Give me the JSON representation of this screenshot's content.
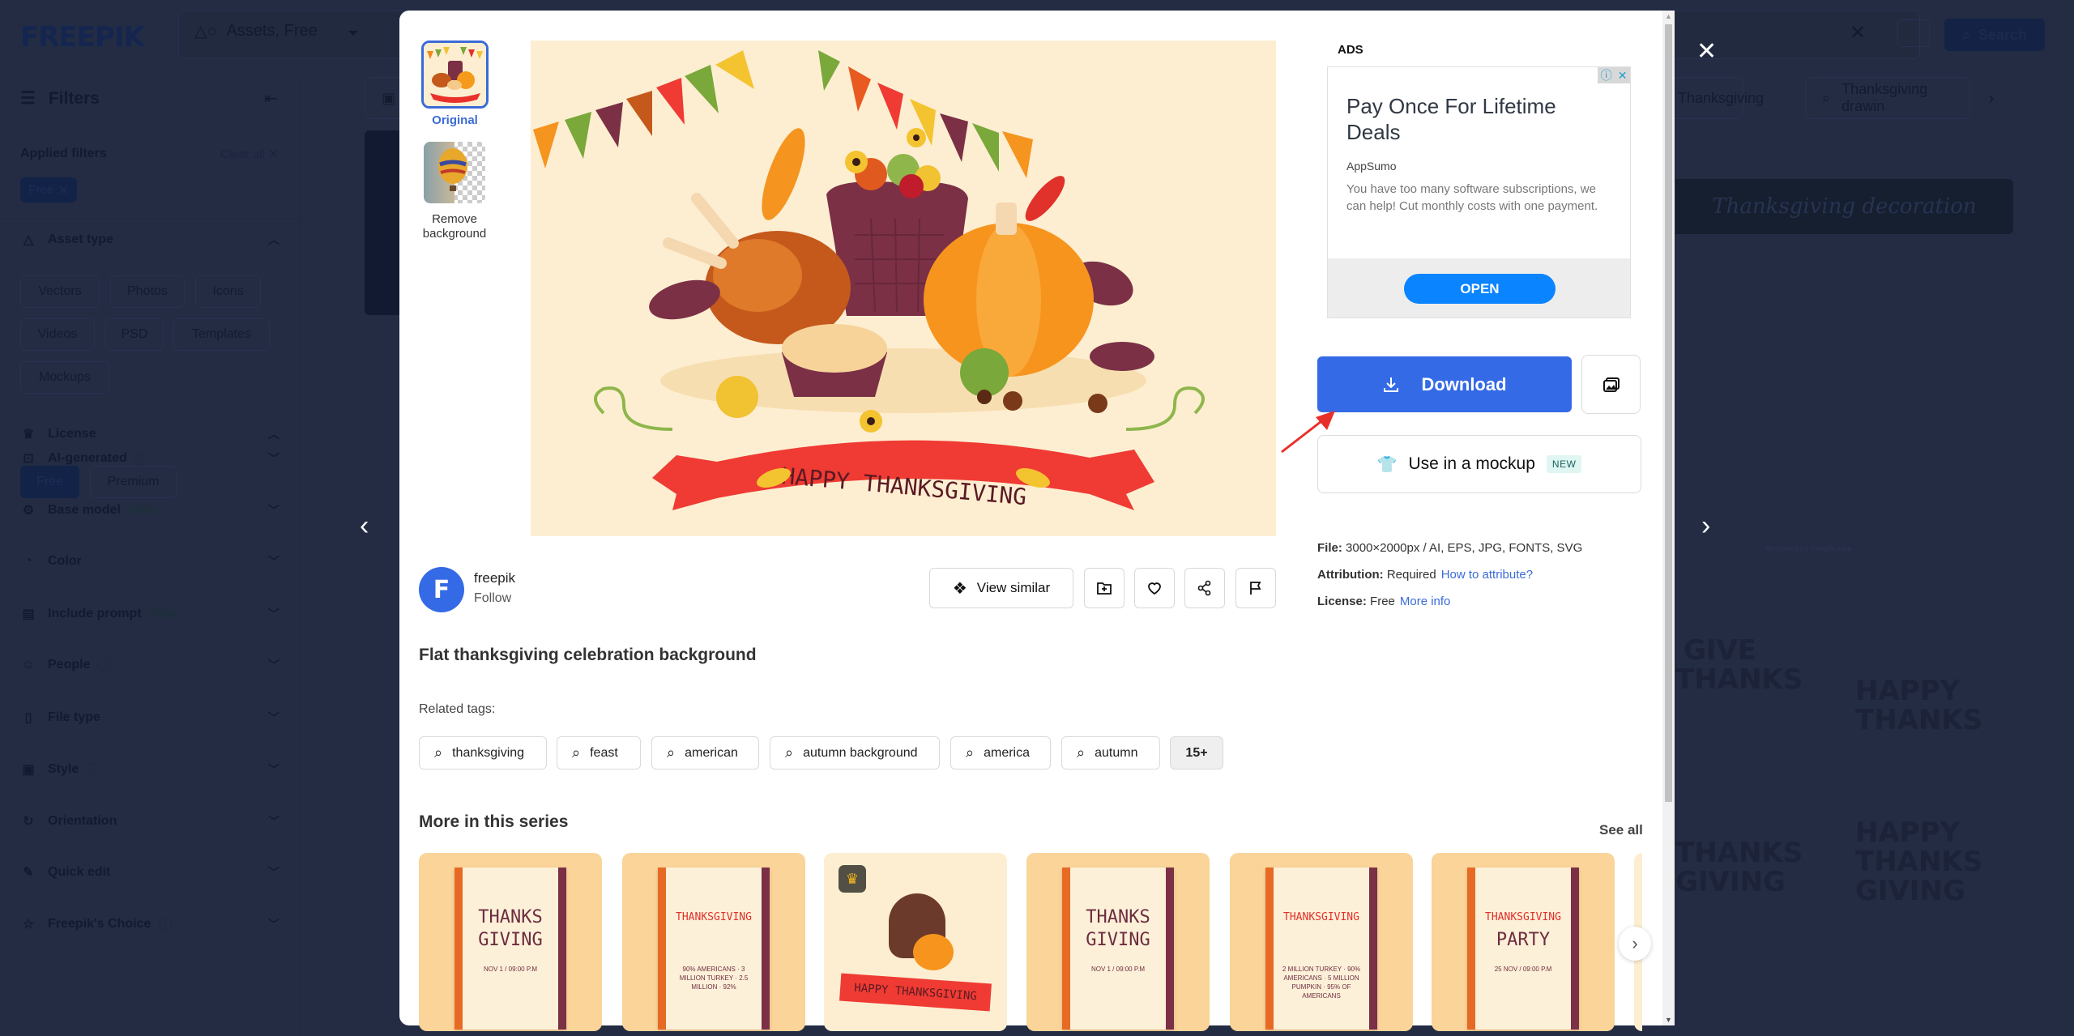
{
  "app": {
    "brand": "FREEPIK"
  },
  "header": {
    "asset_select": "Assets, Free",
    "search_button": "Search"
  },
  "sidebar": {
    "filters_label": "Filters",
    "applied_filters_label": "Applied filters",
    "clear_all_label": "Clear all",
    "applied_chips": [
      "Free"
    ],
    "asset_type": {
      "label": "Asset type",
      "options": [
        "Vectors",
        "Photos",
        "Icons",
        "Videos",
        "PSD",
        "Templates",
        "Mockups"
      ]
    },
    "license": {
      "label": "License",
      "options": [
        "Free",
        "Premium"
      ],
      "selected": "Free"
    },
    "sections": [
      {
        "label": "AI-generated",
        "icon": "ai-icon",
        "badge": "",
        "info": true
      },
      {
        "label": "Base model",
        "icon": "chip-icon",
        "badge": "New",
        "info": false
      },
      {
        "label": "Color",
        "icon": "palette-icon",
        "badge": "",
        "info": false
      },
      {
        "label": "Include prompt",
        "icon": "prompt-icon",
        "badge": "New",
        "info": false
      },
      {
        "label": "People",
        "icon": "person-icon",
        "badge": "",
        "info": true
      },
      {
        "label": "File type",
        "icon": "file-icon",
        "badge": "",
        "info": false
      },
      {
        "label": "Style",
        "icon": "image-sparkle-icon",
        "badge": "",
        "info": true
      },
      {
        "label": "Orientation",
        "icon": "rotate-icon",
        "badge": "",
        "info": false
      },
      {
        "label": "Quick edit",
        "icon": "brush-icon",
        "badge": "",
        "info": false
      },
      {
        "label": "Freepik's Choice",
        "icon": "star-icon",
        "badge": "",
        "info": true
      }
    ]
  },
  "background": {
    "related_searches": [
      "Thanksgiving",
      "Thanksgiving drawin"
    ],
    "decoration_title": "Thanksgiving decoration",
    "credit": "designed by freepik.com",
    "lettering": [
      "GIVE THANKS",
      "HAPPY THANKS",
      "THANKS GIVING",
      "HAPPY THANKS GIVING"
    ]
  },
  "modal": {
    "variants": [
      {
        "label": "Original",
        "selected": true
      },
      {
        "label": "Remove background",
        "selected": false
      }
    ],
    "image_banner_text": "HAPPY THANKSGIVING",
    "ads": {
      "label": "ADS",
      "headline": "Pay Once For Lifetime Deals",
      "advertiser": "AppSumo",
      "description": "You have too many software subscriptions, we can help! Cut monthly costs with one payment.",
      "cta": "OPEN"
    },
    "download_label": "Download",
    "mockup_label": "Use in a mockup",
    "mockup_badge": "NEW",
    "file_info": {
      "file_key": "File:",
      "file_value": "3000×2000px / AI, EPS, JPG, FONTS, SVG",
      "attribution_key": "Attribution:",
      "attribution_value": "Required",
      "attribution_link": "How to attribute?",
      "license_key": "License:",
      "license_value": "Free",
      "license_link": "More info"
    },
    "author": {
      "name": "freepik",
      "follow": "Follow",
      "avatar_letter": "F"
    },
    "view_similar_label": "View similar",
    "title": "Flat thanksgiving celebration background",
    "related_tags_label": "Related tags:",
    "tags": [
      "thanksgiving",
      "feast",
      "american",
      "autumn background",
      "america",
      "autumn"
    ],
    "tags_more": "15+",
    "series": {
      "title": "More in this series",
      "see_all": "See all",
      "cards": [
        {
          "lines": [
            "THANKS",
            "GIVING"
          ],
          "sub": "NOV 1 / 09:00 P.M",
          "premium": false
        },
        {
          "lines": [
            "THANKSGIVING"
          ],
          "sub": "90% AMERICANS · 3 MILLION TURKEY · 2.5 MILLION · 92%",
          "premium": false
        },
        {
          "lines": [
            "HAPPY THANKSGIVING"
          ],
          "sub": "",
          "premium": true
        },
        {
          "lines": [
            "THANKS",
            "GIVING"
          ],
          "sub": "NOV 1 / 09:00 P.M",
          "premium": false
        },
        {
          "lines": [
            "THANKSGIVING"
          ],
          "sub": "2 MILLION TURKEY · 90% AMERICANS · 5 MILLION PUMPKIN · 95% OF AMERICANS",
          "premium": false
        },
        {
          "lines": [
            "THANKSGIVING",
            "PARTY"
          ],
          "sub": "25 NOV / 09:00 P.M",
          "premium": false
        }
      ]
    }
  },
  "colors": {
    "accent": "#346ae6",
    "overlay_bg": "#222b42",
    "ad_cta": "#0a84ff",
    "card_bg": "#fad498"
  }
}
